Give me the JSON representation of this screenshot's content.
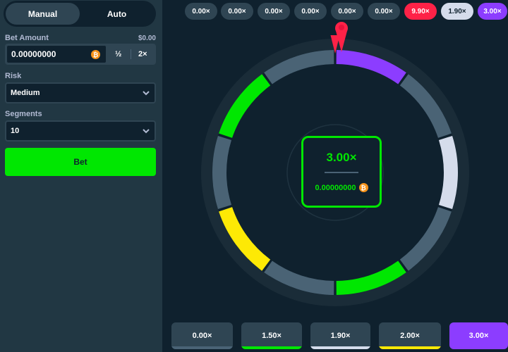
{
  "sidebar": {
    "tabs": [
      {
        "label": "Manual",
        "active": true
      },
      {
        "label": "Auto",
        "active": false
      }
    ],
    "bet_amount": {
      "label": "Bet Amount",
      "usd_value": "$0.00",
      "value": "0.00000000",
      "currency_icon": "bitcoin-icon",
      "half_label": "½",
      "double_label": "2×"
    },
    "risk": {
      "label": "Risk",
      "selected": "Medium"
    },
    "segments": {
      "label": "Segments",
      "selected": "10"
    },
    "bet_button_label": "Bet"
  },
  "history": [
    {
      "label": "0.00×",
      "color": "#2f4553",
      "text_color": "#ffffff"
    },
    {
      "label": "0.00×",
      "color": "#2f4553",
      "text_color": "#ffffff"
    },
    {
      "label": "0.00×",
      "color": "#2f4553",
      "text_color": "#ffffff"
    },
    {
      "label": "0.00×",
      "color": "#2f4553",
      "text_color": "#ffffff"
    },
    {
      "label": "0.00×",
      "color": "#2f4553",
      "text_color": "#ffffff"
    },
    {
      "label": "0.00×",
      "color": "#2f4553",
      "text_color": "#ffffff"
    },
    {
      "label": "9.90×",
      "color": "#fe2247",
      "text_color": "#ffffff"
    },
    {
      "label": "1.90×",
      "color": "#d5dceb",
      "text_color": "#0f212e"
    },
    {
      "label": "3.00×",
      "color": "#8c3dff",
      "text_color": "#ffffff"
    }
  ],
  "wheel": {
    "segment_count": 10,
    "segments": [
      "purple",
      "gray",
      "white",
      "gray",
      "green",
      "gray",
      "yellow",
      "gray",
      "green",
      "gray"
    ],
    "colors": {
      "gray": "#4a6375",
      "green": "#00e701",
      "white": "#d5dceb",
      "yellow": "#fde905",
      "purple": "#8c3dff",
      "pointer": "#fe2247"
    },
    "pointer_icon": "pointer-icon"
  },
  "result": {
    "multiplier": "3.00×",
    "payout": "0.00000000",
    "currency_icon": "bitcoin-icon"
  },
  "multipliers": [
    {
      "label": "0.00×",
      "color": "#4a6375",
      "active": false
    },
    {
      "label": "1.50×",
      "color": "#00e701",
      "active": false
    },
    {
      "label": "1.90×",
      "color": "#d5dceb",
      "active": false
    },
    {
      "label": "2.00×",
      "color": "#fde905",
      "active": false
    },
    {
      "label": "3.00×",
      "color": "#8c3dff",
      "active": true
    }
  ]
}
